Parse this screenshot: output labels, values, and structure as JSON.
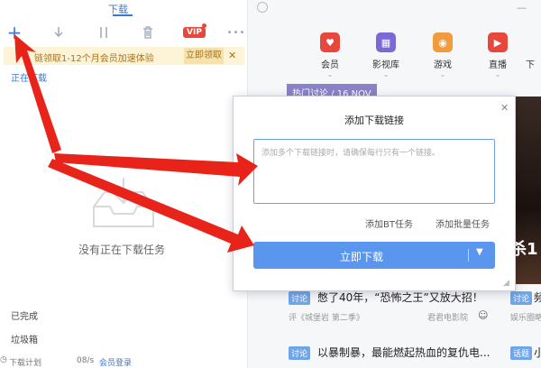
{
  "tab": {
    "label": "下载"
  },
  "toolbar": {
    "icons": [
      "plus-icon",
      "download-arrow-icon",
      "pause-icon",
      "delete-icon",
      "vip-icon",
      "more-icon"
    ],
    "vip_label": "VIP",
    "more_label": "•••"
  },
  "banner": {
    "text": "链领取1-12个月会员加速体验",
    "button": "立即领取",
    "close": "✕"
  },
  "left": {
    "downloading": "正在下载",
    "empty": "没有正在下载任务",
    "completed": "已完成",
    "trash": "垃圾箱",
    "bottom": {
      "plan": "下载计划",
      "speed": "08/s",
      "login": "会员登录"
    }
  },
  "categories": [
    {
      "label": "会员",
      "color": "#e8473c",
      "icon": "vip-icon"
    },
    {
      "label": "影视库",
      "color": "#7b6ad6",
      "icon": "film-icon"
    },
    {
      "label": "游戏",
      "color": "#f19b3c",
      "icon": "game-icon"
    },
    {
      "label": "直播",
      "color": "#e8473c",
      "icon": "live-icon"
    },
    {
      "label": "下",
      "color": "#f6f7f9",
      "icon": "more-icon"
    }
  ],
  "hot": {
    "tag": "热门讨论 / 16 NOV",
    "poster_text": "杀1"
  },
  "feed": [
    {
      "tag": "讨论",
      "title": "憋了40年，“恐怖之王”又放大招！",
      "meta_left": "评《城堡岩 第二季》",
      "meta_right": "君君电影院",
      "side_tag": "讨论",
      "side_title": "频",
      "side_meta": "娱乐圈略"
    },
    {
      "tag": "讨论",
      "title": "以暴制暴，最能燃起热血的复仇电...",
      "side_tag": "话题",
      "side_title": "小"
    }
  ],
  "dialog": {
    "title": "添加下载链接",
    "close": "✕",
    "placeholder": "添加多个下载链接时，请确保每行只有一个链接。",
    "bt": "添加BT任务",
    "batch": "添加批量任务",
    "download": "立即下载"
  }
}
